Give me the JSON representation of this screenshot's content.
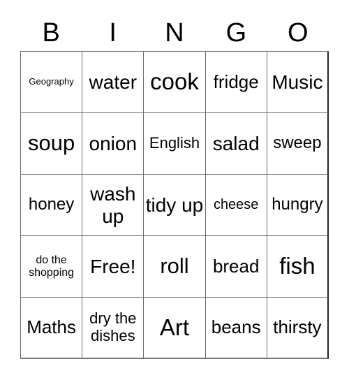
{
  "header": {
    "letters": [
      "B",
      "I",
      "N",
      "G",
      "O"
    ]
  },
  "cells": [
    "Geography",
    "water",
    "cook",
    "fridge",
    "Music",
    "soup",
    "onion",
    "English",
    "salad",
    "sweep",
    "honey",
    "wash up",
    "tidy up",
    "cheese",
    "hungry",
    "do the shopping",
    "Free!",
    "roll",
    "bread",
    "fish",
    "Maths",
    "dry the dishes",
    "Art",
    "beans",
    "thirsty"
  ]
}
